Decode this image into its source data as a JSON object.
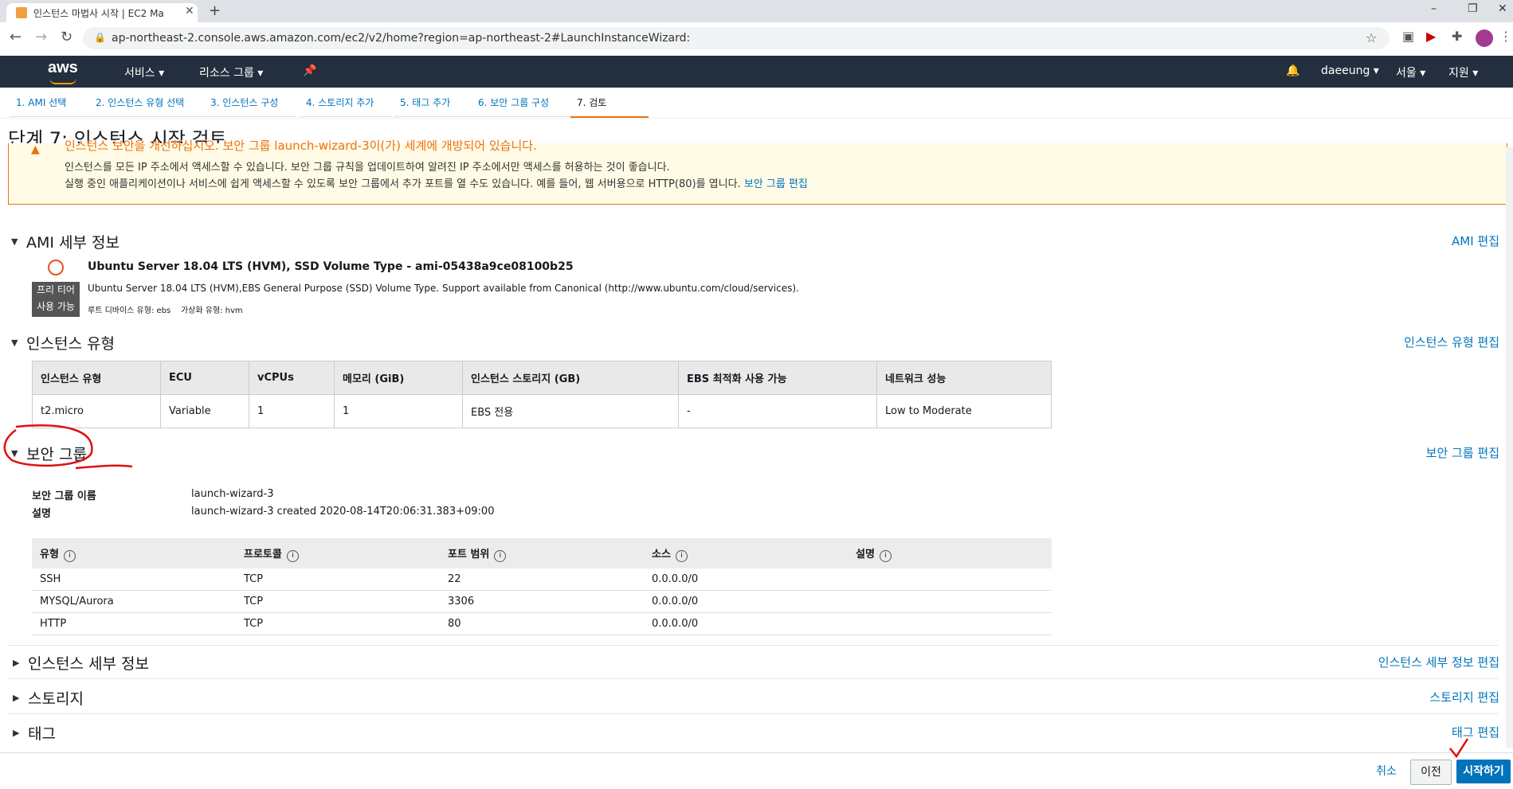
{
  "browser": {
    "tab_title": "인스턴스 마법사 시작 | EC2 Ma",
    "url": "ap-northeast-2.console.aws.amazon.com/ec2/v2/home?region=ap-northeast-2#LaunchInstanceWizard:"
  },
  "awsnav": {
    "logo": "aws",
    "services": "서비스",
    "resource_groups": "리소스 그룹",
    "user": "daeeung",
    "region": "서울",
    "support": "지원"
  },
  "steps": [
    "1. AMI 선택",
    "2. 인스턴스 유형 선택",
    "3. 인스턴스 구성",
    "4. 스토리지 추가",
    "5. 태그 추가",
    "6. 보안 그룹 구성",
    "7. 검토"
  ],
  "page_title": "단계 7: 인스턴스 시작 검토",
  "warning": {
    "title": "인스턴스 보안을 개선하십시오. 보안 그룹 launch-wizard-3이(가) 세계에 개방되어 있습니다.",
    "line1": "인스턴스를 모든 IP 주소에서 액세스할 수 있습니다. 보안 그룹 규칙을 업데이트하여 알려진 IP 주소에서만 액세스를 허용하는 것이 좋습니다.",
    "line2": "실행 중인 애플리케이션이나 서비스에 쉽게 액세스할 수 있도록 보안 그룹에서 추가 포트를 열 수도 있습니다. 예를 들어, 웹 서버용으로 HTTP(80)를 엽니다.",
    "link": "보안 그룹 편집"
  },
  "ami": {
    "section": "AMI 세부 정보",
    "edit": "AMI 편집",
    "name": "Ubuntu Server 18.04 LTS (HVM), SSD Volume Type - ami-05438a9ce08100b25",
    "desc": "Ubuntu Server 18.04 LTS (HVM),EBS General Purpose (SSD) Volume Type. Support available from Canonical (http://www.ubuntu.com/cloud/services).",
    "free_tier_1": "프리 티어",
    "free_tier_2": "사용 가능",
    "root_device": "루트 디바이스 유형: ebs",
    "virtualization": "가상화 유형: hvm"
  },
  "instance_type": {
    "section": "인스턴스 유형",
    "edit": "인스턴스 유형 편집",
    "headers": [
      "인스턴스 유형",
      "ECU",
      "vCPUs",
      "메모리 (GiB)",
      "인스턴스 스토리지 (GB)",
      "EBS 최적화 사용 가능",
      "네트워크 성능"
    ],
    "row": [
      "t2.micro",
      "Variable",
      "1",
      "1",
      "EBS 전용",
      "-",
      "Low to Moderate"
    ]
  },
  "security_group": {
    "section": "보안 그룹",
    "edit": "보안 그룹 편집",
    "name_label": "보안 그룹 이름",
    "name_value": "launch-wizard-3",
    "desc_label": "설명",
    "desc_value": "launch-wizard-3 created 2020-08-14T20:06:31.383+09:00",
    "headers": [
      "유형",
      "프로토콜",
      "포트 범위",
      "소스",
      "설명"
    ],
    "rows": [
      [
        "SSH",
        "TCP",
        "22",
        "0.0.0.0/0",
        ""
      ],
      [
        "MYSQL/Aurora",
        "TCP",
        "3306",
        "0.0.0.0/0",
        ""
      ],
      [
        "HTTP",
        "TCP",
        "80",
        "0.0.0.0/0",
        ""
      ]
    ]
  },
  "collapsed": [
    {
      "title": "인스턴스 세부 정보",
      "edit": "인스턴스 세부 정보 편집"
    },
    {
      "title": "스토리지",
      "edit": "스토리지 편집"
    },
    {
      "title": "태그",
      "edit": "태그 편집"
    }
  ],
  "footer": {
    "cancel": "취소",
    "prev": "이전",
    "launch": "시작하기"
  },
  "colors": {
    "aws_nav": "#232f3e",
    "accent": "#ec7211",
    "link": "#0073bb",
    "launch": "#0073bb"
  }
}
